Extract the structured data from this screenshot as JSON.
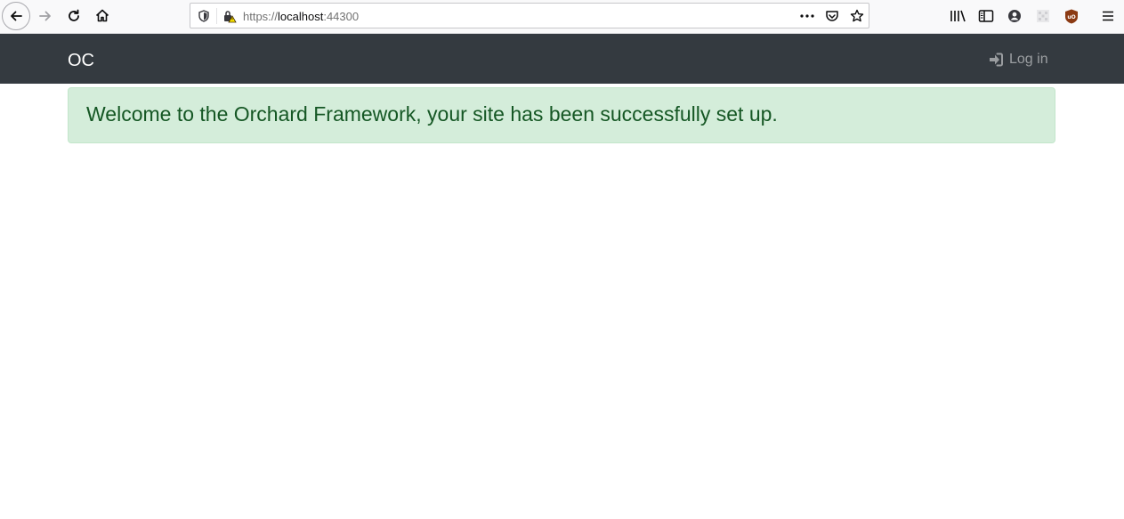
{
  "browser": {
    "url_scheme": "https://",
    "url_host": "localhost",
    "url_port": ":44300"
  },
  "site": {
    "brand": "OC",
    "login_label": "Log in"
  },
  "alert": {
    "message": "Welcome to the Orchard Framework, your site has been successfully set up.",
    "bg_color": "#d4edda",
    "text_color": "#155724"
  },
  "colors": {
    "navbar": "#343a40",
    "ublock_badge": "#8b3a13"
  },
  "icons": [
    "back-arrow-icon",
    "forward-arrow-icon",
    "reload-icon",
    "home-icon",
    "shield-icon",
    "lock-warning-icon",
    "more-dots-icon",
    "pocket-icon",
    "star-icon",
    "library-icon",
    "sidebar-icon",
    "account-icon",
    "extension-icon",
    "ublock-icon",
    "menu-icon",
    "sign-in-icon"
  ]
}
